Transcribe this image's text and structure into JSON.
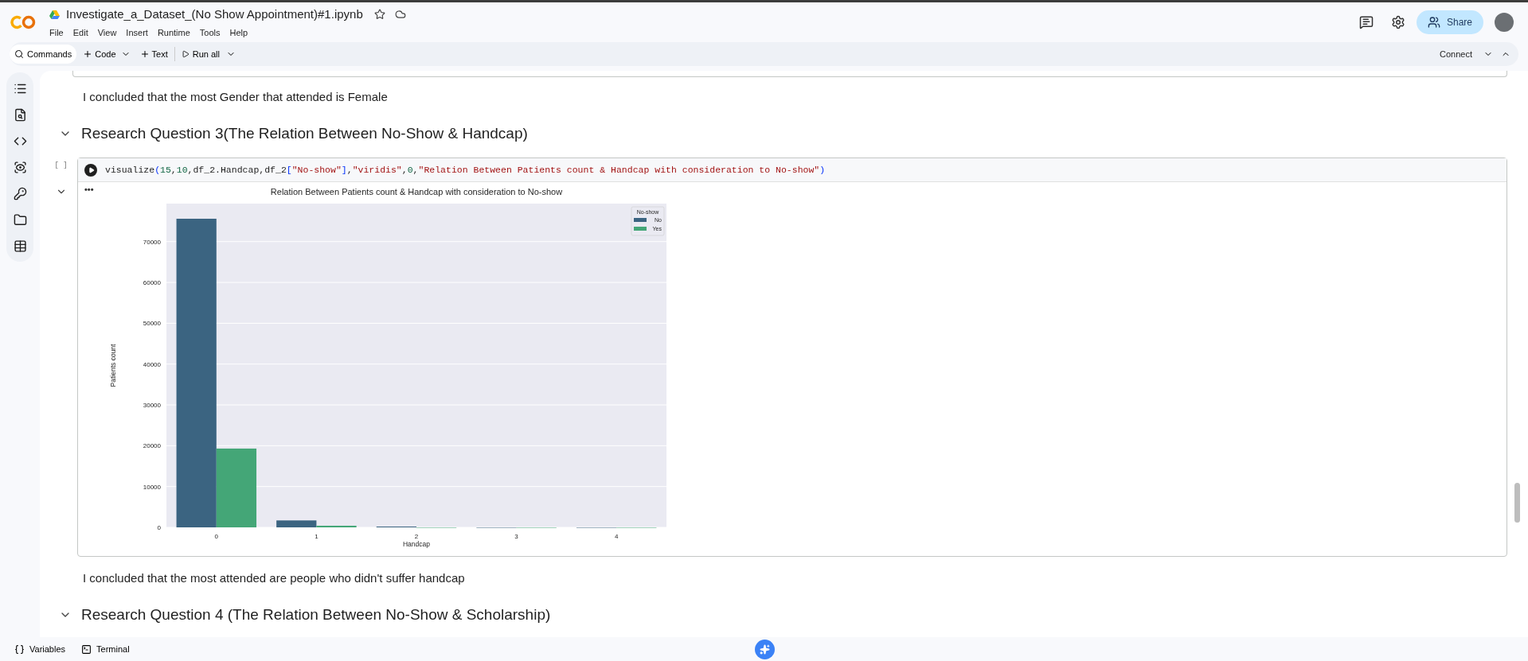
{
  "header": {
    "file_name": "Investigate_a_Dataset_(No Show Appointment)#1.ipynb",
    "menu": [
      "File",
      "Edit",
      "View",
      "Insert",
      "Runtime",
      "Tools",
      "Help"
    ],
    "share_label": "Share"
  },
  "toolbar": {
    "commands": "Commands",
    "add_code": "Code",
    "add_text": "Text",
    "run_all": "Run all",
    "connect": "Connect"
  },
  "cells": [
    {
      "kind": "text",
      "text": "I concluded that the most Gender that attended is Female"
    },
    {
      "kind": "heading",
      "text": "Research Question 3(The Relation Between No-Show & Handcap)"
    },
    {
      "kind": "code",
      "prompt": "[ ]",
      "code": [
        {
          "kind": "plain",
          "text": "visualize"
        },
        {
          "kind": "paren",
          "text": "("
        },
        {
          "kind": "number",
          "text": "15"
        },
        {
          "kind": "plain",
          "text": ","
        },
        {
          "kind": "number",
          "text": "10"
        },
        {
          "kind": "plain",
          "text": ",df_2.Handcap,df_2"
        },
        {
          "kind": "paren",
          "text": "["
        },
        {
          "kind": "string",
          "text": "\"No-show\""
        },
        {
          "kind": "paren",
          "text": "]"
        },
        {
          "kind": "plain",
          "text": ","
        },
        {
          "kind": "string",
          "text": "\"viridis\""
        },
        {
          "kind": "plain",
          "text": ","
        },
        {
          "kind": "number",
          "text": "0"
        },
        {
          "kind": "plain",
          "text": ","
        },
        {
          "kind": "string",
          "text": "\"Relation Between Patients count & Handcap with consideration to No-show\""
        },
        {
          "kind": "paren",
          "text": ")"
        }
      ],
      "output_menu": "•••",
      "chart_data": {
        "type": "bar",
        "title": "Relation Between Patients count & Handcap with consideration to No-show",
        "xlabel": "Handcap",
        "ylabel": "Patients count",
        "categories": [
          "0",
          "1",
          "2",
          "3",
          "4"
        ],
        "series": [
          {
            "name": "No",
            "color": "#3b6481",
            "values": [
              75600,
              1700,
              200,
              0,
              0
            ]
          },
          {
            "name": "Yes",
            "color": "#44a677",
            "values": [
              19300,
              400,
              0,
              0,
              0
            ]
          }
        ],
        "legend": {
          "title": "No-show"
        },
        "grid": true,
        "ylim": [
          0,
          79300
        ],
        "yticks": [
          0,
          10000,
          20000,
          30000,
          40000,
          50000,
          60000,
          70000
        ]
      }
    },
    {
      "kind": "text",
      "text": "I concluded that the most attended are people who didn't suffer handcap"
    },
    {
      "kind": "heading",
      "text": "Research Question 4 (The Relation Between No-Show & Scholarship)"
    }
  ],
  "bottom_bar": {
    "variables": "Variables",
    "terminal": "Terminal"
  }
}
